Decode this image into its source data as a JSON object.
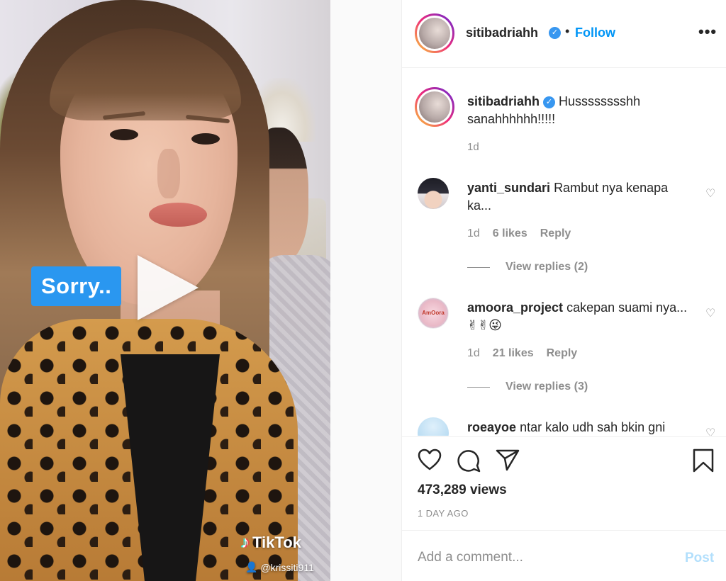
{
  "video": {
    "overlay_label": "Sorry..",
    "watermark_brand": "TikTok",
    "watermark_user": "@krissiti911",
    "play_icon": "play-icon"
  },
  "header": {
    "username": "sitibadriahh",
    "separator": "•",
    "follow_label": "Follow",
    "more_label": "•••",
    "colors": {
      "follow": "#0095f6",
      "verified": "#3897f0"
    }
  },
  "caption": {
    "username": "sitibadriahh",
    "text": "Husssssssshh sanahhhhhh!!!!!",
    "time": "1d"
  },
  "comments": [
    {
      "username": "yanti_sundari",
      "text": "Rambut nya kenapa ka...",
      "time": "1d",
      "likes": "6 likes",
      "reply_label": "Reply",
      "view_replies": "View replies (2)"
    },
    {
      "username": "amoora_project",
      "avatar_text": "AmOora",
      "text": "cakepan suami nya...✌✌😜",
      "time": "1d",
      "likes": "21 likes",
      "reply_label": "Reply",
      "view_replies": "View replies (3)"
    },
    {
      "username": "roeayoe",
      "text": "ntar kalo udh sah bkin gni"
    }
  ],
  "actions": {
    "views": "473,289 views",
    "date": "1 DAY AGO",
    "icons": [
      "heart-icon",
      "comment-icon",
      "share-icon",
      "bookmark-icon"
    ]
  },
  "add_comment": {
    "placeholder": "Add a comment...",
    "post_label": "Post",
    "post_color": "#b2dffc"
  }
}
